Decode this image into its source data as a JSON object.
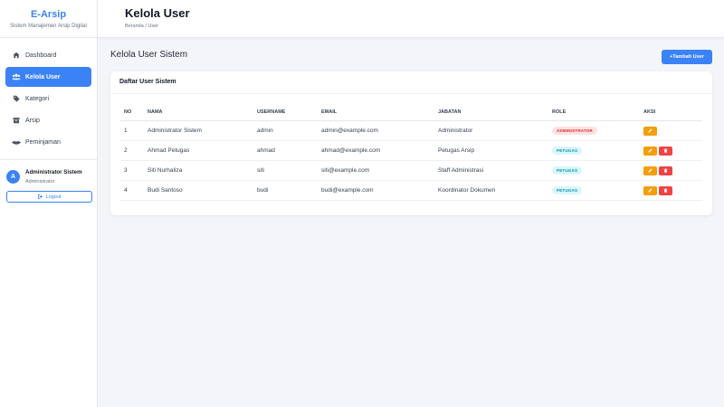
{
  "brand": {
    "title": "E-Arsip",
    "subtitle": "Sistem Manajemen Arsip Digital"
  },
  "sidebar": {
    "items": [
      {
        "label": "Dashboard",
        "icon": "home-icon"
      },
      {
        "label": "Kelola User",
        "icon": "users-icon",
        "active": true
      },
      {
        "label": "Kategori",
        "icon": "tag-icon"
      },
      {
        "label": "Arsip",
        "icon": "archive-icon"
      },
      {
        "label": "Peminjaman",
        "icon": "handshake-icon"
      }
    ],
    "user": {
      "initial": "A",
      "name": "Administrator Sistem",
      "role": "Administrator"
    },
    "logout_label": "Logout"
  },
  "header": {
    "title": "Kelola User",
    "breadcrumb": "Beranda / User"
  },
  "main": {
    "section_title": "Kelola User Sistem",
    "add_button": "Tambah User",
    "card_title": "Daftar User Sistem",
    "columns": [
      "NO",
      "NAMA",
      "USERNAME",
      "EMAIL",
      "JABATAN",
      "ROLE",
      "AKSI"
    ],
    "rows": [
      {
        "no": "1",
        "nama": "Administrator Sistem",
        "username": "admin",
        "email": "admin@example.com",
        "jabatan": "Administrator",
        "role": "ADMINISTRATOR",
        "role_type": "admin"
      },
      {
        "no": "2",
        "nama": "Ahmad Petugas",
        "username": "ahmad",
        "email": "ahmad@example.com",
        "jabatan": "Petugas Arsip",
        "role": "PETUGAS",
        "role_type": "petugas"
      },
      {
        "no": "3",
        "nama": "Siti Nurhaliza",
        "username": "siti",
        "email": "siti@example.com",
        "jabatan": "Staff Administrasi",
        "role": "PETUGAS",
        "role_type": "petugas"
      },
      {
        "no": "4",
        "nama": "Budi Santoso",
        "username": "budi",
        "email": "budi@example.com",
        "jabatan": "Koordinator Dokumen",
        "role": "PETUGAS",
        "role_type": "petugas"
      }
    ]
  },
  "colors": {
    "primary": "#3b82f6",
    "edit": "#f59e0b",
    "delete": "#ef4444",
    "admin_badge": "#dc2626",
    "petugas_badge": "#0891b2"
  }
}
